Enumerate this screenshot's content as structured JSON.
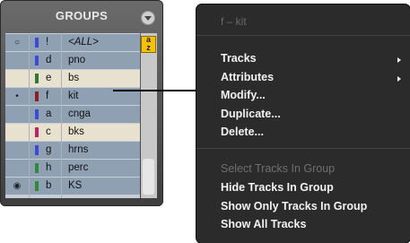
{
  "groups_panel": {
    "title": "GROUPS",
    "sort_button_label": "a\nz",
    "rows": [
      {
        "dot": "○",
        "color": "#3a4bd6",
        "id": "!",
        "name": "<ALL>",
        "style": "sel"
      },
      {
        "dot": "",
        "color": "#3a4bd6",
        "id": "d",
        "name": "pno",
        "style": "sel"
      },
      {
        "dot": "",
        "color": "#2f7a2f",
        "id": "e",
        "name": "bs",
        "style": "hl"
      },
      {
        "dot": "•",
        "color": "#8a2020",
        "id": "f",
        "name": "kit",
        "style": "sel"
      },
      {
        "dot": "",
        "color": "#3a4bd6",
        "id": "a",
        "name": "cnga",
        "style": "sel"
      },
      {
        "dot": "",
        "color": "#c0206a",
        "id": "c",
        "name": "bks",
        "style": "hl"
      },
      {
        "dot": "",
        "color": "#3a4bd6",
        "id": "g",
        "name": "hrns",
        "style": "sel"
      },
      {
        "dot": "",
        "color": "#2f8a3a",
        "id": "h",
        "name": "perc",
        "style": "sel"
      },
      {
        "dot": "◉",
        "color": "#2f8a3a",
        "id": "b",
        "name": "KS",
        "style": "sel"
      }
    ]
  },
  "context_menu": {
    "title": "f – kit",
    "items": [
      {
        "label": "Tracks",
        "submenu": true,
        "enabled": true
      },
      {
        "label": "Attributes",
        "submenu": true,
        "enabled": true
      },
      {
        "label": "Modify...",
        "submenu": false,
        "enabled": true
      },
      {
        "label": "Duplicate...",
        "submenu": false,
        "enabled": true
      },
      {
        "label": "Delete...",
        "submenu": false,
        "enabled": true
      },
      {
        "label": "Select Tracks In Group",
        "submenu": false,
        "enabled": false
      },
      {
        "label": "Hide Tracks In Group",
        "submenu": false,
        "enabled": true
      },
      {
        "label": "Show Only Tracks In Group",
        "submenu": false,
        "enabled": true
      },
      {
        "label": "Show All Tracks",
        "submenu": false,
        "enabled": true
      }
    ]
  }
}
